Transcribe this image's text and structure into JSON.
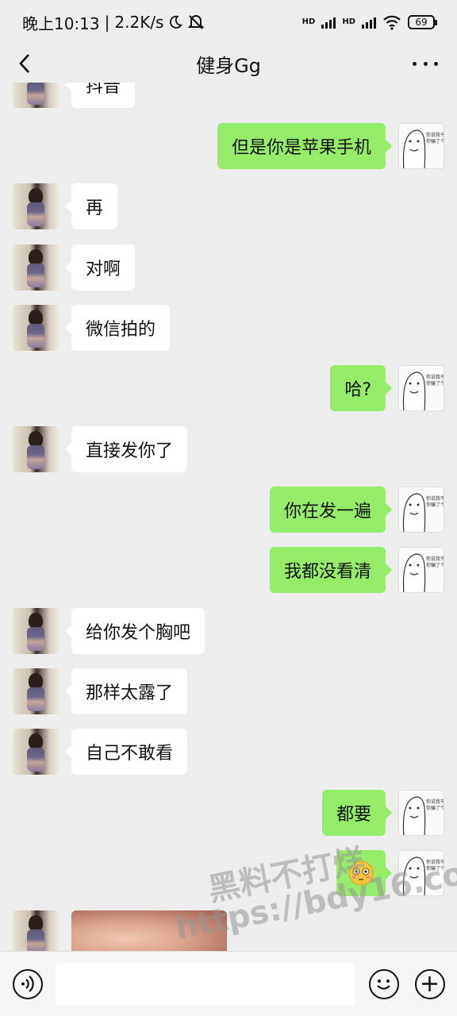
{
  "status_bar": {
    "time": "晚上10:13",
    "network_speed": "2.2K/s",
    "net_label_1": "HD",
    "net_label_2": "HD",
    "battery": "69"
  },
  "nav": {
    "title": "健身Gg",
    "back_icon": "chevron-left-icon",
    "more_icon": "more-dots-icon"
  },
  "messages": [
    {
      "side": "in",
      "text": "抖音",
      "partial": true
    },
    {
      "side": "out",
      "text": "但是你是苹果手机"
    },
    {
      "side": "in",
      "text": "再"
    },
    {
      "side": "in",
      "text": "对啊"
    },
    {
      "side": "in",
      "text": "微信拍的"
    },
    {
      "side": "out",
      "text": "哈?"
    },
    {
      "side": "in",
      "text": "直接发你了"
    },
    {
      "side": "out",
      "text": "你在发一遍"
    },
    {
      "side": "out",
      "text": "我都没看清"
    },
    {
      "side": "in",
      "text": "给你发个胸吧"
    },
    {
      "side": "in",
      "text": "那样太露了"
    },
    {
      "side": "in",
      "text": "自己不敢看"
    },
    {
      "side": "out",
      "text": "都要"
    },
    {
      "side": "out",
      "text": "😳",
      "emoji": true
    },
    {
      "side": "in",
      "text": "",
      "image": true
    }
  ],
  "meme_avatar_caption": [
    "你说我干啥",
    "你骗了个寂"
  ],
  "watermark": {
    "line1": "黑料不打烊",
    "line2": "https://bdy16.co"
  },
  "input_bar": {
    "voice_icon": "voice-icon",
    "emoji_icon": "emoji-icon",
    "plus_icon": "plus-icon",
    "placeholder": ""
  },
  "colors": {
    "background": "#ededed",
    "bubble_out": "#95ec69",
    "bubble_in": "#ffffff"
  }
}
